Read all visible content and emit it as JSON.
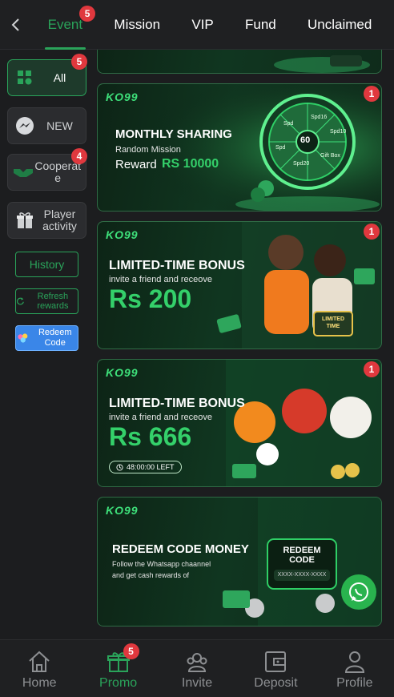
{
  "topnav": {
    "tabs": [
      {
        "label": "Event",
        "badge": "5"
      },
      {
        "label": "Mission"
      },
      {
        "label": "VIP"
      },
      {
        "label": "Fund"
      },
      {
        "label": "Unclaimed"
      }
    ]
  },
  "sidebar": {
    "items": [
      {
        "label": "All",
        "badge": "5",
        "icon": "grid-icon"
      },
      {
        "label": "NEW",
        "icon": "messenger-icon"
      },
      {
        "label": "Cooperat e",
        "badge": "4",
        "icon": "handshake-icon"
      },
      {
        "label": "Player activity",
        "icon": "gift-icon"
      }
    ],
    "history_label": "History",
    "refresh_label": "Refresh rewards",
    "redeem_label": "Redeem Code"
  },
  "banners": [
    {
      "logo": "KO99",
      "badge": "1",
      "title": "MONTHLY SHARING",
      "subtitle": "Random Mission",
      "reward_prefix": "Reward",
      "reward_value": "RS 10000",
      "wheel_center": "60",
      "wheel_labels": [
        "Spd16",
        "Spd",
        "Gift Box",
        "Spd20",
        "Spd",
        "Spd10"
      ]
    },
    {
      "logo": "KO99",
      "badge": "1",
      "title": "LIMITED-TIME BONUS",
      "subtitle": "invite a friend and receove",
      "amount": "Rs 200",
      "tag": "LIMITED TIME"
    },
    {
      "logo": "KO99",
      "badge": "1",
      "title": "LIMITED-TIME BONUS",
      "subtitle": "invite a friend and receove",
      "amount": "Rs 666",
      "timer": "48:00:00 LEFT"
    },
    {
      "logo": "KO99",
      "title": "REDEEM CODE MONEY",
      "subtitle_line1": "Follow the Whatsapp chaannel",
      "subtitle_line2": "and get cash rewards of",
      "card_title": "REDEEM CODE",
      "card_code": "XXXX-XXXX-XXXX"
    }
  ],
  "bottomnav": {
    "items": [
      {
        "label": "Home",
        "icon": "home-icon"
      },
      {
        "label": "Promo",
        "icon": "gift-icon",
        "badge": "5"
      },
      {
        "label": "Invite",
        "icon": "invite-icon"
      },
      {
        "label": "Deposit",
        "icon": "wallet-icon"
      },
      {
        "label": "Profile",
        "icon": "profile-icon"
      }
    ]
  },
  "colors": {
    "accent": "#2aa35a",
    "badge": "#e0383e",
    "background": "#1c1d1f",
    "panel": "#2b2c2f"
  }
}
